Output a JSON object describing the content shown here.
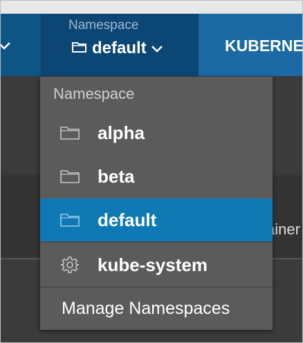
{
  "nav": {
    "namespace_label": "Namespace",
    "namespace_value": "default",
    "title": "KUBERNE"
  },
  "dropdown": {
    "header": "Namespace",
    "items": [
      {
        "label": "alpha",
        "icon": "folder-icon",
        "selected": false
      },
      {
        "label": "beta",
        "icon": "folder-icon",
        "selected": false
      },
      {
        "label": "default",
        "icon": "folder-icon",
        "selected": true
      },
      {
        "label": "kube-system",
        "icon": "gear-icon",
        "selected": false
      }
    ],
    "manage_label": "Manage Namespaces"
  },
  "background": {
    "partial_text": "ainer"
  },
  "colors": {
    "nav_bg": "#1a5d8e",
    "nav_active": "#0b4675",
    "dropdown_bg": "#5b5b5b",
    "selected_bg": "#0e79b2"
  }
}
